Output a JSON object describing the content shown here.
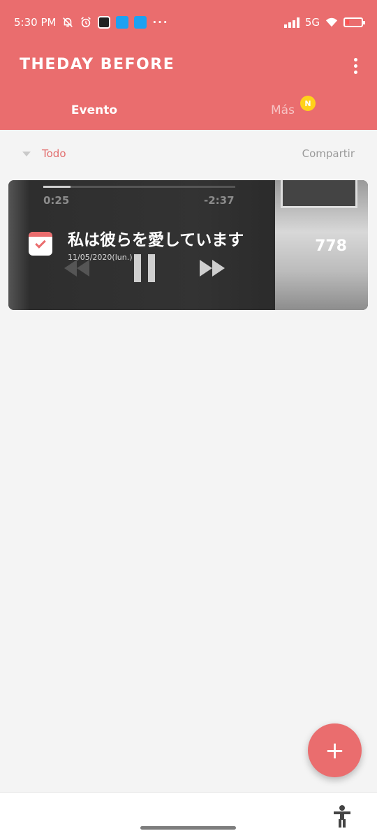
{
  "status": {
    "time": "5:30 PM",
    "network": "5G",
    "battery_level": 0.18,
    "battery_color": "#ff5050",
    "notification_icons": [
      "mute-icon",
      "alarm-icon",
      "watch-app-icon",
      "twitter-icon",
      "twitter-icon",
      "more-dots-icon"
    ]
  },
  "app": {
    "logo": "THEDAY BEFORE",
    "brand_color": "#ea6d6e"
  },
  "tabs": [
    {
      "label": "Evento",
      "active": true
    },
    {
      "label": "Más",
      "active": false,
      "badge": "N"
    }
  ],
  "filter": {
    "label": "Todo",
    "share_label": "Compartir"
  },
  "event": {
    "title": "私は彼らを愛しています",
    "date": "11/05/2020(lun.)",
    "count": "778",
    "player": {
      "elapsed": "0:25",
      "remaining": "-2:37",
      "progress": 0.14
    }
  },
  "fab": {
    "symbol": "+"
  }
}
